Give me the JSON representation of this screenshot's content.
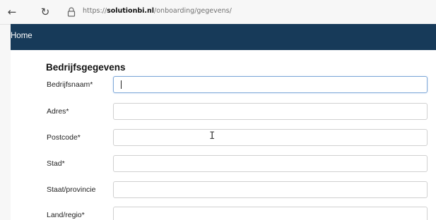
{
  "browser": {
    "url_prefix": "https://",
    "url_domain": "solutionbi.nl",
    "url_path": "/onboarding/gegevens/"
  },
  "header": {
    "home_label": "Home"
  },
  "form": {
    "title": "Bedrijfsgegevens",
    "fields": [
      {
        "label": "Bedrijfsnaam*",
        "value": ""
      },
      {
        "label": "Adres*",
        "value": ""
      },
      {
        "label": "Postcode*",
        "value": ""
      },
      {
        "label": "Stad*",
        "value": ""
      },
      {
        "label": "Staat/provincie",
        "value": ""
      },
      {
        "label": "Land/regio*",
        "value": ""
      }
    ]
  },
  "colors": {
    "header_bg": "#173a59",
    "focus_border": "#80a9d8"
  }
}
